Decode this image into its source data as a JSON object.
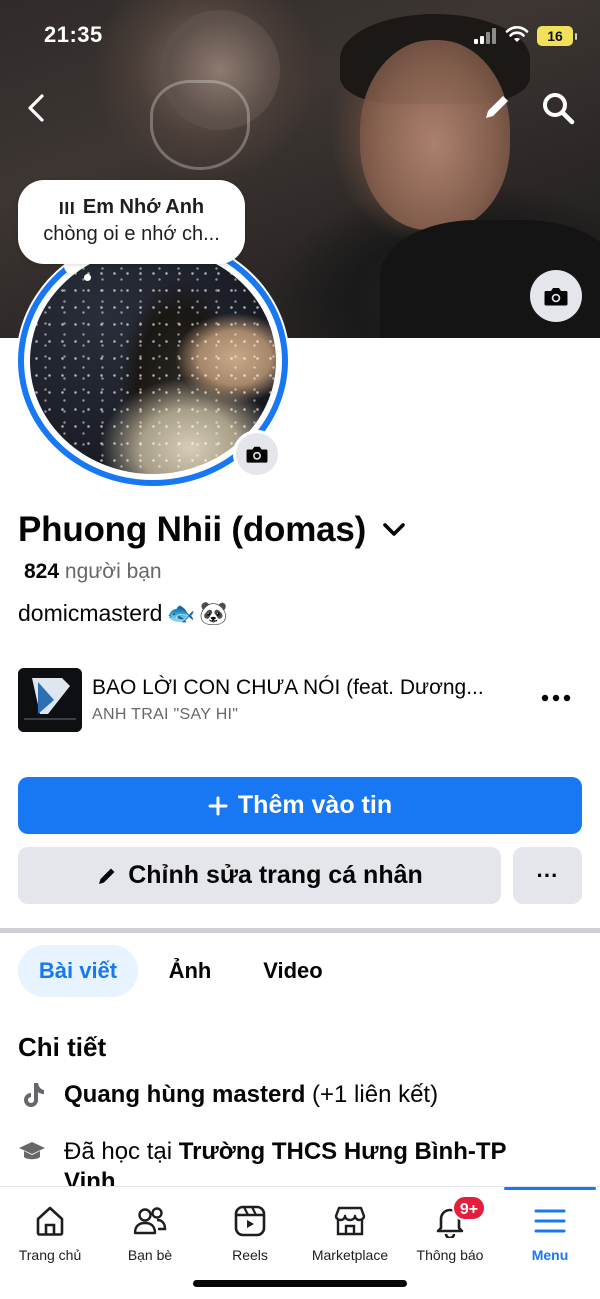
{
  "status_bar": {
    "time": "21:35",
    "battery": "16"
  },
  "cover": {
    "alt": "cover photo"
  },
  "note": {
    "title": "Em Nhớ Anh",
    "text": "chòng oi e nhớ ch..."
  },
  "profile": {
    "name": "Phuong Nhii (domas)",
    "friends_count": "824",
    "friends_label": "người bạn",
    "bio": "domicmasterd",
    "bio_emojis": [
      "🐟",
      "🐼"
    ]
  },
  "music": {
    "title": "BAO LỜI CON CHƯA NÓI (feat. Dương...",
    "artist": "ANH TRAI \"SAY HI\"",
    "album_text": "ANH TRAI \"SAY HI\""
  },
  "actions": {
    "add_story": "Thêm vào tin",
    "edit_profile": "Chỉnh sửa trang cá nhân",
    "more": "···"
  },
  "tabs": [
    "Bài viết",
    "Ảnh",
    "Video"
  ],
  "details": {
    "title": "Chi tiết",
    "tiktok_name": "Quang hùng masterd",
    "tiktok_extra": "(+1 liên kết)",
    "school_prefix": "Đã học tại",
    "school_name": "Trường THCS Hưng Bình-TP",
    "school_cut": "Vinh"
  },
  "bottom_nav": {
    "home": "Trang chủ",
    "friends": "Bạn bè",
    "reels": "Reels",
    "marketplace": "Marketplace",
    "notifications": "Thông báo",
    "menu": "Menu",
    "badge": "9+"
  },
  "colors": {
    "accent": "#1877f2",
    "badge": "#e41e3f",
    "button_gray": "#e4e6eb"
  },
  "icons": [
    "back-icon",
    "edit-icon",
    "search-icon",
    "camera-icon",
    "chevron-down-icon",
    "more-icon",
    "plus-icon",
    "pencil-icon",
    "tiktok-icon",
    "graduation-icon",
    "home-icon",
    "friends-icon",
    "reels-icon",
    "marketplace-icon",
    "bell-icon",
    "menu-icon"
  ]
}
